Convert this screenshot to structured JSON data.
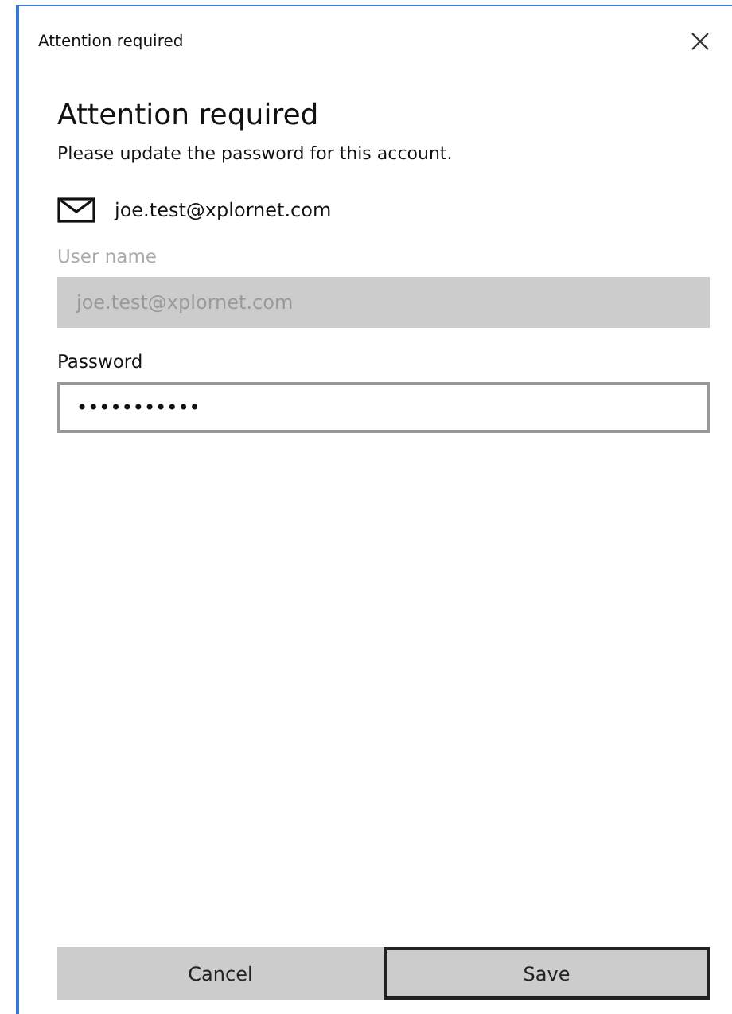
{
  "window": {
    "title": "Attention required"
  },
  "heading": "Attention required",
  "message": "Please update the password for this account.",
  "account": {
    "email": "joe.test@xplornet.com"
  },
  "fields": [
    {
      "label": "User name",
      "value": "joe.test@xplornet.com",
      "disabled": true
    },
    {
      "label": "Password",
      "value": "•••••••••••",
      "disabled": false
    }
  ],
  "buttons": [
    {
      "label": "Cancel",
      "default": false
    },
    {
      "label": "Save",
      "default": true
    }
  ]
}
